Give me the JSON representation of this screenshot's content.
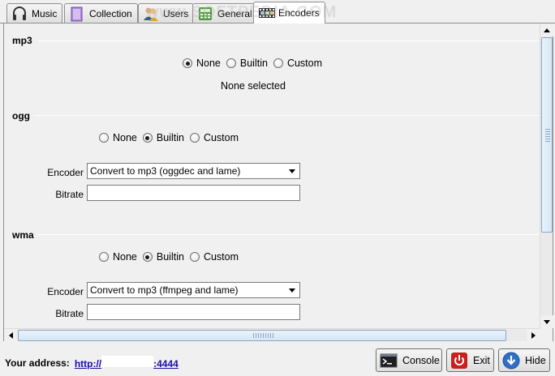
{
  "tabs": [
    {
      "label": "Music",
      "icon": "headphones-icon",
      "active": false
    },
    {
      "label": "Collection",
      "icon": "collection-icon",
      "active": false
    },
    {
      "label": "Users",
      "icon": "users-icon",
      "active": false
    },
    {
      "label": "General",
      "icon": "calculator-icon",
      "active": false
    },
    {
      "label": "Encoders",
      "icon": "film-strip-icon",
      "active": true
    }
  ],
  "watermark": "www.SOFTPEDIA.COM",
  "radio_options": [
    "None",
    "Builtin",
    "Custom"
  ],
  "sections": {
    "mp3": {
      "title": "mp3",
      "selected": "None",
      "status": "None selected"
    },
    "ogg": {
      "title": "ogg",
      "selected": "Builtin",
      "encoder_label": "Encoder",
      "encoder_value": "Convert to mp3 (oggdec and lame)",
      "bitrate_label": "Bitrate",
      "bitrate_value": ""
    },
    "wma": {
      "title": "wma",
      "selected": "Builtin",
      "encoder_label": "Encoder",
      "encoder_value": "Convert to mp3 (ffmpeg and lame)",
      "bitrate_label": "Bitrate",
      "bitrate_value": ""
    }
  },
  "footer": {
    "address_label": "Your address:",
    "address_prefix": "http://",
    "address_suffix": ":4444",
    "buttons": {
      "console": "Console",
      "exit": "Exit",
      "hide": "Hide"
    }
  },
  "colors": {
    "link": "#1a0dab",
    "exit_icon": "#c8201d",
    "hide_icon": "#2f6fc9"
  }
}
